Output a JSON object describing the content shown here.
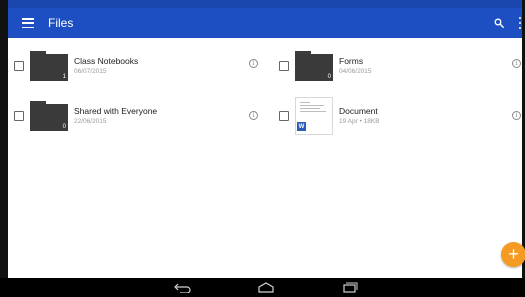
{
  "app": {
    "title": "Files"
  },
  "icons": {
    "menu": "hamburger-menu-icon",
    "search": "search-icon",
    "overflow": "more-vert-icon",
    "info": "info-icon",
    "add": "plus-icon",
    "back": "back-icon",
    "home": "home-icon",
    "recents": "recents-icon"
  },
  "colors": {
    "appbar": "#1e4fc2",
    "fab": "#f59a23",
    "folder": "#3a3a3a",
    "word": "#2b5cb8"
  },
  "items": [
    {
      "name": "Class Notebooks",
      "date": "06/07/2015",
      "count": "1",
      "kind": "folder"
    },
    {
      "name": "Forms",
      "date": "04/06/2015",
      "count": "0",
      "kind": "folder"
    },
    {
      "name": "Shared with Everyone",
      "date": "22/06/2015",
      "count": "0",
      "kind": "folder"
    },
    {
      "name": "Document",
      "date": "19 Apr • 18KB",
      "kind": "word-document"
    }
  ],
  "fab": {
    "label": "+"
  }
}
